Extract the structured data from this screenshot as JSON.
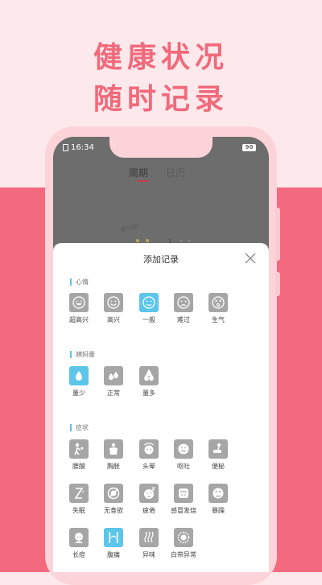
{
  "headline": {
    "line1": "健康状况",
    "line2": "随时记录"
  },
  "status_bar": {
    "time": "16:34",
    "battery": "90"
  },
  "tabs": [
    {
      "label": "周期"
    },
    {
      "label": "日历"
    }
  ],
  "background_peek": {
    "label": "易孕期",
    "number": "1"
  },
  "sheet": {
    "title": "添加记录",
    "sections": {
      "mood": {
        "title": "心情",
        "items": [
          {
            "label": "超高兴",
            "icon": "very-happy-face-icon",
            "selected": false
          },
          {
            "label": "高兴",
            "icon": "happy-face-icon",
            "selected": false
          },
          {
            "label": "一般",
            "icon": "neutral-face-icon",
            "selected": true
          },
          {
            "label": "难过",
            "icon": "sad-face-icon",
            "selected": false
          },
          {
            "label": "生气",
            "icon": "angry-face-icon",
            "selected": false
          }
        ]
      },
      "flow": {
        "title": "姨妈量",
        "items": [
          {
            "label": "量少",
            "icon": "one-drop-icon",
            "selected": true
          },
          {
            "label": "正常",
            "icon": "two-drops-icon",
            "selected": false
          },
          {
            "label": "量多",
            "icon": "three-drops-icon",
            "selected": false
          }
        ]
      },
      "symptoms": {
        "title": "症状",
        "items": [
          {
            "label": "腰酸",
            "icon": "backache-icon",
            "selected": false
          },
          {
            "label": "胸胀",
            "icon": "breast-swelling-icon",
            "selected": false
          },
          {
            "label": "头晕",
            "icon": "dizzy-icon",
            "selected": false
          },
          {
            "label": "呕吐",
            "icon": "vomit-icon",
            "selected": false
          },
          {
            "label": "便秘",
            "icon": "constipation-icon",
            "selected": false
          },
          {
            "label": "失眠",
            "icon": "insomnia-icon",
            "selected": false
          },
          {
            "label": "无食欲",
            "icon": "no-appetite-icon",
            "selected": false
          },
          {
            "label": "疲倦",
            "icon": "tired-icon",
            "selected": false
          },
          {
            "label": "感冒发烧",
            "icon": "fever-icon",
            "selected": false
          },
          {
            "label": "暴躁",
            "icon": "irritable-icon",
            "selected": false
          },
          {
            "label": "长痘",
            "icon": "acne-icon",
            "selected": false
          },
          {
            "label": "腹痛",
            "icon": "abdominal-pain-icon",
            "selected": true
          },
          {
            "label": "异味",
            "icon": "odor-icon",
            "selected": false
          },
          {
            "label": "白带异常",
            "icon": "discharge-icon",
            "selected": false
          }
        ]
      }
    }
  },
  "colors": {
    "accent_pink": "#f06a7c",
    "bottom_band": "#f36a7e",
    "top_band": "#fde9ec",
    "selected_tile": "#5bc6ea",
    "tile": "#a6a6a6"
  }
}
